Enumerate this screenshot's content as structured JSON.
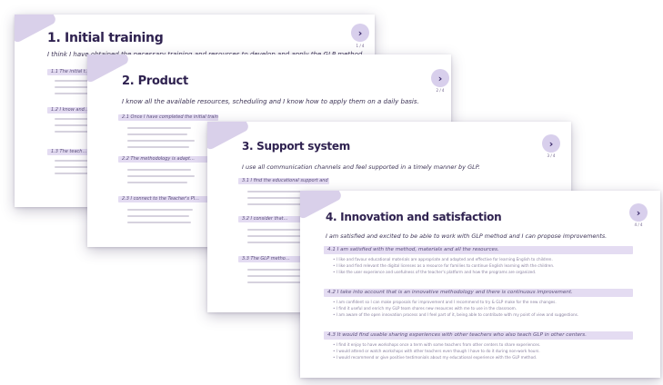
{
  "cards": [
    {
      "title": "1. Initial training",
      "subtitle": "I think I have obtained the necessary training and resources to develop and apply the GLP method.",
      "page": "1 / 4",
      "sections": [
        "1.1 The initial t…",
        "1.2 I know and…",
        "1.3 The teach…"
      ]
    },
    {
      "title": "2. Product",
      "subtitle": "I know all the available resources, scheduling and I know how to apply them on a daily basis.",
      "page": "2 / 4",
      "sections": [
        "2.1 Once I have completed the initial training and first sessions, I feel comfortable with the GLP method.",
        "2.2 The methodology is adapt…",
        "2.3 I connect to the Teacher's Pl…"
      ]
    },
    {
      "title": "3. Support system",
      "subtitle": "I use all communication channels and feel supported in a timely manner by GLP.",
      "page": "3 / 4",
      "sections": [
        "3.1 I find the educational support and communication channels with GLP comfortable and fluid.",
        "3.2 I consider that…",
        "3.3 The GLP metho…"
      ]
    },
    {
      "title": "4. Innovation and satisfaction",
      "subtitle": "I am satisfied and excited to be able to work with GLP method and I can propose improvements.",
      "page": "4 / 4",
      "sections": [
        {
          "heading": "4.1 I am satisfied with the method, materials and all the resources.",
          "bullets": [
            "I like and favour educational materials are appropriate and adapted and effective for learning English to children.",
            "I like and find relevant the digital licenses as a resource for families to continue English learning with the children.",
            "I like the user experience and usefulness of the teacher's platform and how the programs are organized."
          ]
        },
        {
          "heading": "4.2 I take into account that is an innovative methodology and there is continuous improvement.",
          "bullets": [
            "I am confident so I can make proposals for improvement and I recommend to try & GLP make for the new changes.",
            "I find it useful and enrich my GLP team shares new resources with me to use in the classroom.",
            "I am aware of the open innovation process and I feel part of it, being able to contribute with my point of view and suggestions."
          ]
        },
        {
          "heading": "4.3 It would find usable sharing experiences with other teachers who also teach GLP in other centers.",
          "bullets": [
            "I find it enjoy to have workshops once a term with some teachers from other centers to share experiences.",
            "I would attend or watch workshops with other teachers even though I have to do it during non-work hours.",
            "I would recommend or give positive testimonials about my educational experience with the GLP method."
          ]
        }
      ]
    }
  ],
  "colors": {
    "accent": "#d8cfec",
    "section_bar": "#e4dcf2",
    "title": "#2f2250"
  }
}
